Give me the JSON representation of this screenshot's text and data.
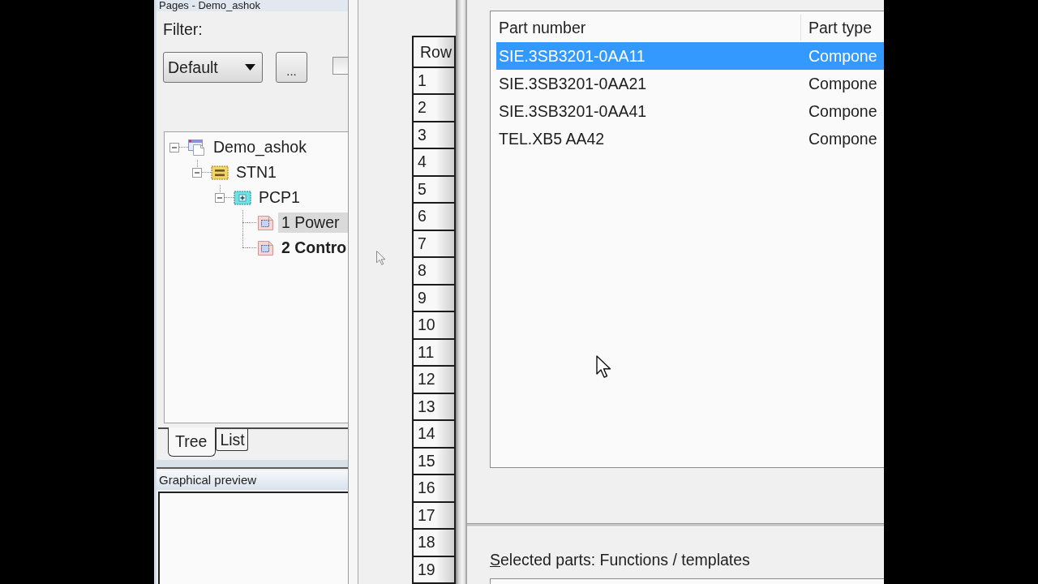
{
  "pages_panel": {
    "title": "Pages - Demo_ashok",
    "filter_label": "Filter:",
    "filter_dropdown": {
      "value": "Default"
    },
    "more_button": {
      "label": "..."
    },
    "checkbox": {
      "checked": false
    },
    "tree": [
      {
        "label": "Demo_ashok",
        "kind": "project",
        "expanded": true,
        "selected": false,
        "children": [
          {
            "label": "STN1",
            "kind": "station",
            "expanded": true,
            "selected": false,
            "children": [
              {
                "label": "PCP1",
                "kind": "panel",
                "expanded": true,
                "selected": false,
                "children": [
                  {
                    "label": "1 Power",
                    "kind": "page",
                    "selected": true,
                    "bold": false
                  },
                  {
                    "label": "2 Contro",
                    "kind": "page",
                    "selected": false,
                    "bold": true
                  }
                ]
              }
            ]
          }
        ]
      }
    ],
    "tabs": [
      {
        "label": "Tree",
        "selected": true
      },
      {
        "label": "List",
        "selected": false
      }
    ]
  },
  "graphical_preview": {
    "title": "Graphical preview"
  },
  "row_grid": {
    "header": "Row",
    "rows": [
      "1",
      "2",
      "3",
      "4",
      "5",
      "6",
      "7",
      "8",
      "9",
      "10",
      "11",
      "12",
      "13",
      "14",
      "15",
      "16",
      "17",
      "18",
      "19"
    ]
  },
  "parts_list": {
    "columns": [
      "Part number",
      "Part type"
    ],
    "rows": [
      {
        "cells": [
          "SIE.3SB3201-0AA11",
          "Compone"
        ],
        "selected": true
      },
      {
        "cells": [
          "SIE.3SB3201-0AA21",
          "Compone"
        ],
        "selected": false
      },
      {
        "cells": [
          "SIE.3SB3201-0AA41",
          "Compone"
        ],
        "selected": false
      },
      {
        "cells": [
          "TEL.XB5 AA42",
          "Compone"
        ],
        "selected": false
      }
    ]
  },
  "selected_parts": {
    "label": "Selected parts: Functions / templates"
  }
}
